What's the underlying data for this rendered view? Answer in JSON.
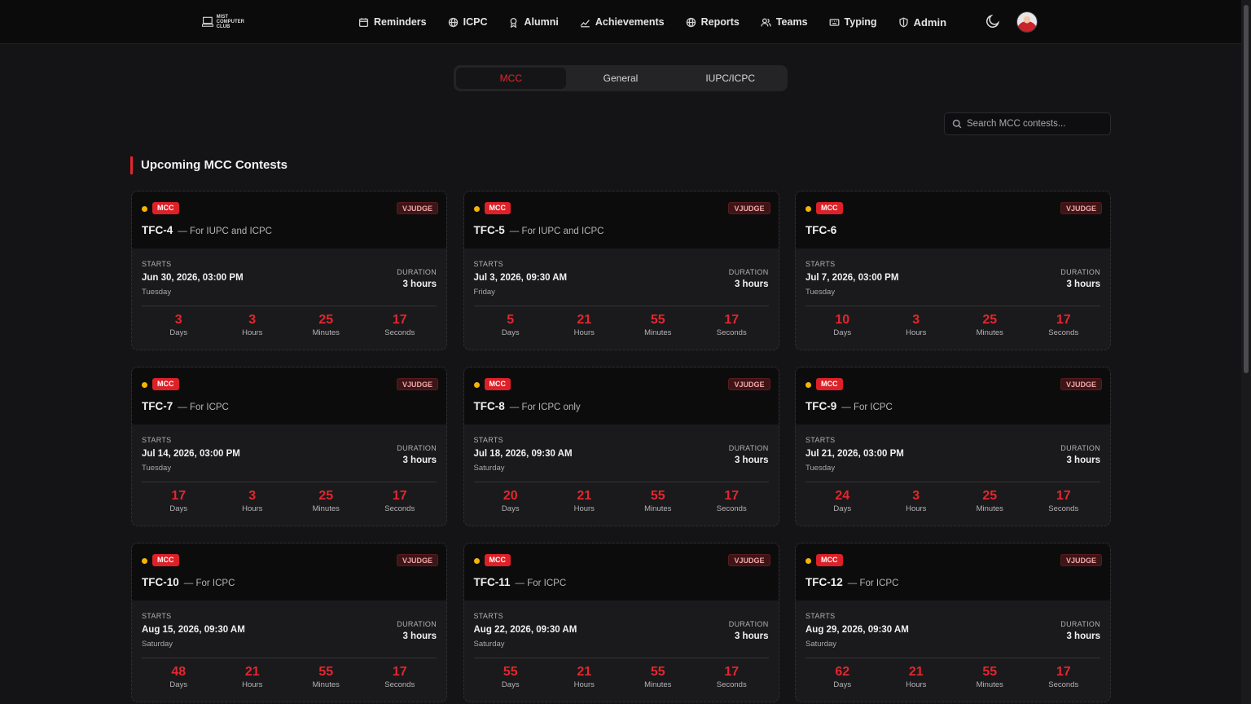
{
  "nav": {
    "logo_text": [
      "MIST",
      "COMPUTER",
      "CLUB"
    ],
    "items": [
      {
        "label": "Reminders",
        "icon": "calendar-icon"
      },
      {
        "label": "ICPC",
        "icon": "globe-icon"
      },
      {
        "label": "Alumni",
        "icon": "award-icon"
      },
      {
        "label": "Achievements",
        "icon": "chart-icon"
      },
      {
        "label": "Reports",
        "icon": "globe-icon"
      },
      {
        "label": "Teams",
        "icon": "users-icon"
      },
      {
        "label": "Typing",
        "icon": "keyboard-icon"
      },
      {
        "label": "Admin",
        "icon": "shield-icon"
      }
    ]
  },
  "tabs": [
    {
      "label": "MCC",
      "active": true
    },
    {
      "label": "General",
      "active": false
    },
    {
      "label": "IUPC/ICPC",
      "active": false
    }
  ],
  "search": {
    "placeholder": "Search MCC contests..."
  },
  "section": {
    "title": "Upcoming MCC Contests"
  },
  "labels": {
    "badge": "MCC",
    "platform": "VJUDGE",
    "starts": "STARTS",
    "duration": "DURATION",
    "days": "Days",
    "hours": "Hours",
    "minutes": "Minutes",
    "seconds": "Seconds"
  },
  "colors": {
    "accent": "#e4262f",
    "dot": "#f5b500",
    "background": "#141416"
  },
  "contests": [
    {
      "name": "TFC-4",
      "subtitle": "— For IUPC and ICPC",
      "start": "Jun 30, 2026, 03:00 PM",
      "day": "Tuesday",
      "duration": "3 hours",
      "cd": [
        "3",
        "3",
        "25",
        "17"
      ]
    },
    {
      "name": "TFC-5",
      "subtitle": "— For IUPC and ICPC",
      "start": "Jul 3, 2026, 09:30 AM",
      "day": "Friday",
      "duration": "3 hours",
      "cd": [
        "5",
        "21",
        "55",
        "17"
      ]
    },
    {
      "name": "TFC-6",
      "subtitle": "",
      "start": "Jul 7, 2026, 03:00 PM",
      "day": "Tuesday",
      "duration": "3 hours",
      "cd": [
        "10",
        "3",
        "25",
        "17"
      ]
    },
    {
      "name": "TFC-7",
      "subtitle": "— For ICPC",
      "start": "Jul 14, 2026, 03:00 PM",
      "day": "Tuesday",
      "duration": "3 hours",
      "cd": [
        "17",
        "3",
        "25",
        "17"
      ]
    },
    {
      "name": "TFC-8",
      "subtitle": "— For ICPC only",
      "start": "Jul 18, 2026, 09:30 AM",
      "day": "Saturday",
      "duration": "3 hours",
      "cd": [
        "20",
        "21",
        "55",
        "17"
      ]
    },
    {
      "name": "TFC-9",
      "subtitle": "— For ICPC",
      "start": "Jul 21, 2026, 03:00 PM",
      "day": "Tuesday",
      "duration": "3 hours",
      "cd": [
        "24",
        "3",
        "25",
        "17"
      ]
    },
    {
      "name": "TFC-10",
      "subtitle": "— For ICPC",
      "start": "Aug 15, 2026, 09:30 AM",
      "day": "Saturday",
      "duration": "3 hours",
      "cd": [
        "48",
        "21",
        "55",
        "17"
      ]
    },
    {
      "name": "TFC-11",
      "subtitle": "— For ICPC",
      "start": "Aug 22, 2026, 09:30 AM",
      "day": "Saturday",
      "duration": "3 hours",
      "cd": [
        "55",
        "21",
        "55",
        "17"
      ]
    },
    {
      "name": "TFC-12",
      "subtitle": "— For ICPC",
      "start": "Aug 29, 2026, 09:30 AM",
      "day": "Saturday",
      "duration": "3 hours",
      "cd": [
        "62",
        "21",
        "55",
        "17"
      ]
    }
  ]
}
